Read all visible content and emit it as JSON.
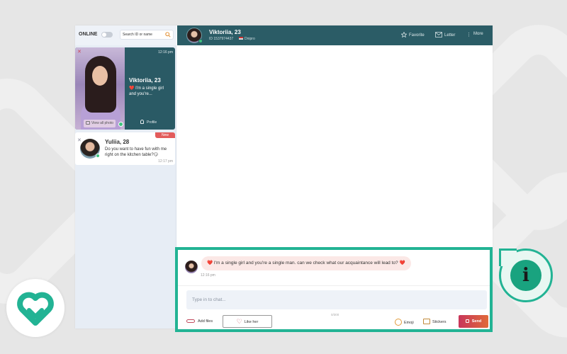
{
  "sidebar": {
    "online_label": "ONLINE",
    "search_placeholder": "Search ID or name",
    "cards": [
      {
        "name": "Viktoriia, 23",
        "time": "12:16 pm",
        "message": "❤️ I'm a single girl and you're...",
        "view_photo_label": "View all photo",
        "profile_label": "Profile"
      },
      {
        "name": "Yuliia, 28",
        "badge": "New",
        "message": "Do you want to have fun with me right on the kitchen table?😏",
        "time": "12:17 pm"
      }
    ]
  },
  "header": {
    "name": "Viktoriia, 23",
    "id_text": "ID 1537974437",
    "country": "Dnipro",
    "actions": {
      "favorite": "Favorite",
      "letter": "Letter",
      "more": "More"
    }
  },
  "chat": {
    "message_text": "❤️ I'm a single girl and you're a single man. can we check what our acquaintance will lead to? ❤️",
    "message_time": "12:16 pm",
    "input_placeholder": "Type in to chat...",
    "char_count": "0/300",
    "add_files_label": "Add files",
    "like_label": "Like her",
    "emoji_label": "Emoji",
    "stickers_label": "Stickers",
    "send_label": "Send"
  },
  "info_icon_text": "i",
  "colors": {
    "header_bg": "#2b5c66",
    "highlight": "#22b394",
    "send_gradient_start": "#c8365a",
    "send_gradient_end": "#e06a3a",
    "new_badge": "#e25b5b",
    "online": "#3ec27d"
  },
  "icons": [
    "search-icon",
    "close-icon",
    "camera-icon",
    "user-icon",
    "star-icon",
    "envelope-icon",
    "more-icon",
    "paperclip-icon",
    "heart-icon",
    "emoji-icon",
    "sticker-icon",
    "lock-icon",
    "info-icon",
    "logo-icon"
  ]
}
